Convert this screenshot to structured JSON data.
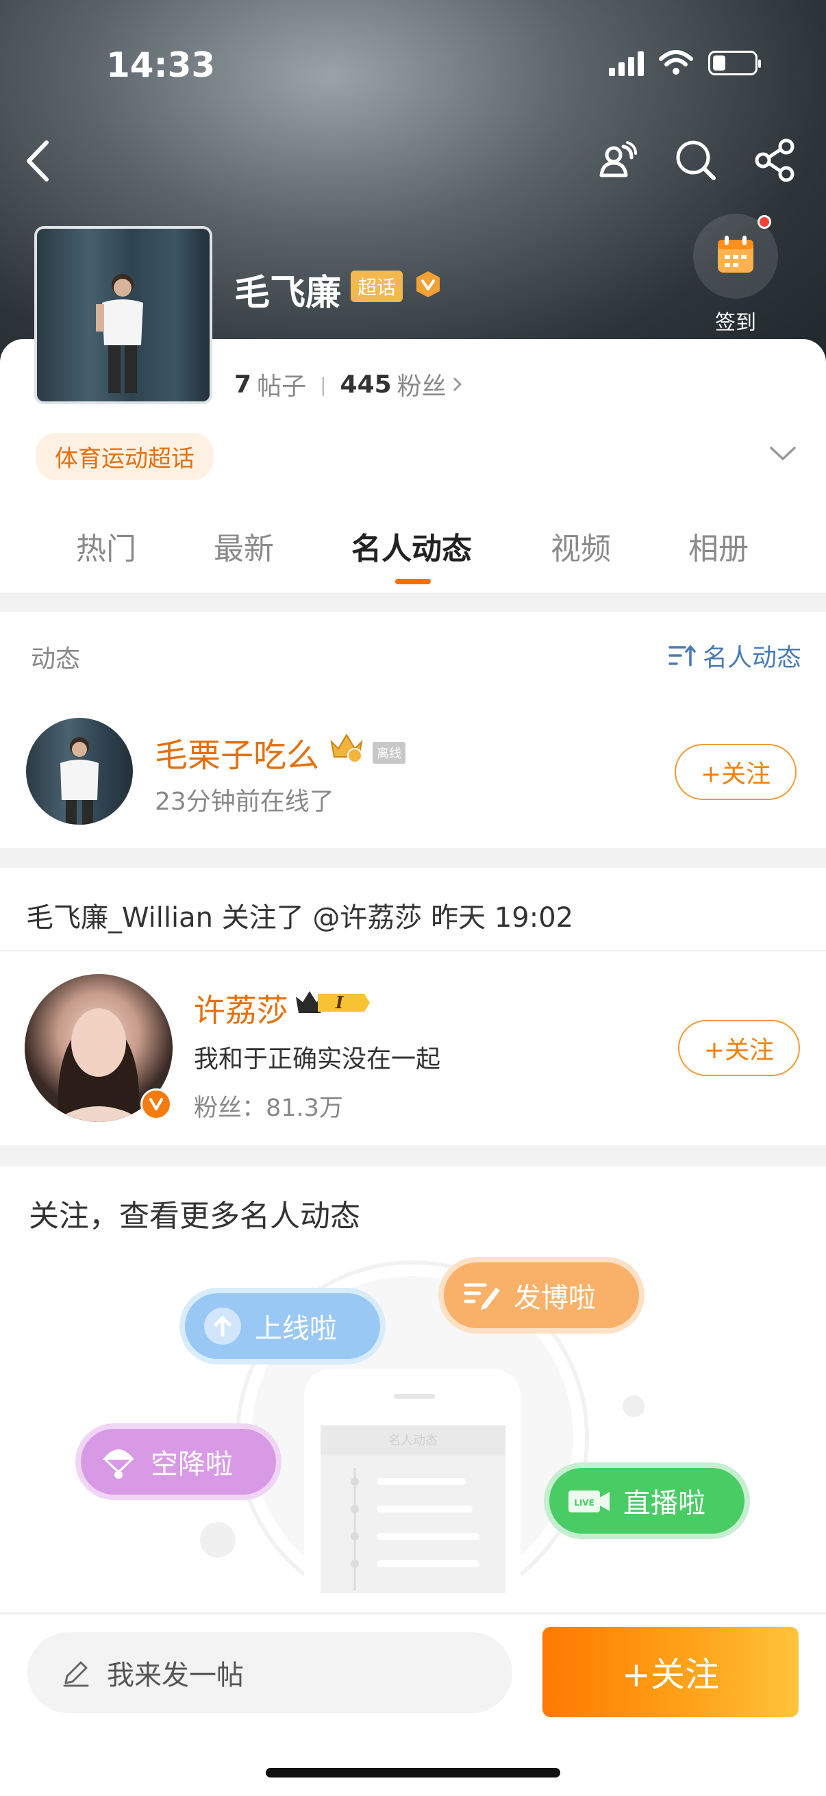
{
  "status_bar": {
    "time": "14:33"
  },
  "header": {
    "name": "毛飞廉",
    "chaohua_badge": "超话",
    "signin_label": "签到",
    "stats": {
      "posts_count": "7",
      "posts_label": "帖子",
      "fans_count": "445",
      "fans_label": "粉丝"
    },
    "category": "体育运动超话"
  },
  "tabs": [
    {
      "label": "热门"
    },
    {
      "label": "最新"
    },
    {
      "label": "名人动态"
    },
    {
      "label": "视频"
    },
    {
      "label": "相册"
    }
  ],
  "feed": {
    "section_title": "动态",
    "section_action": "名人动态",
    "user": {
      "name": "毛栗子吃么",
      "offline_tag": "离线",
      "status": "23分钟前在线了",
      "follow_label": "+关注"
    },
    "activity": {
      "headline": "毛飞廉_Willian 关注了 @许荔莎 昨天 19:02",
      "person": {
        "name": "许荔莎",
        "level": "I",
        "description": "我和于正确实没在一起",
        "fans": "粉丝：81.3万",
        "follow_label": "+关注"
      }
    },
    "promo": {
      "title": "关注，查看更多名人动态",
      "chips": {
        "online": "上线啦",
        "post": "发博啦",
        "arrive": "空降啦",
        "live": "直播啦",
        "live_tag": "LIVE"
      },
      "phone_label": "名人动态"
    }
  },
  "bottom": {
    "post_placeholder": "我来发一帖",
    "follow_label": "+关注"
  },
  "colors": {
    "accent": "#ff7a00",
    "link": "#4a7bb4",
    "orange_text": "#e4700c"
  }
}
